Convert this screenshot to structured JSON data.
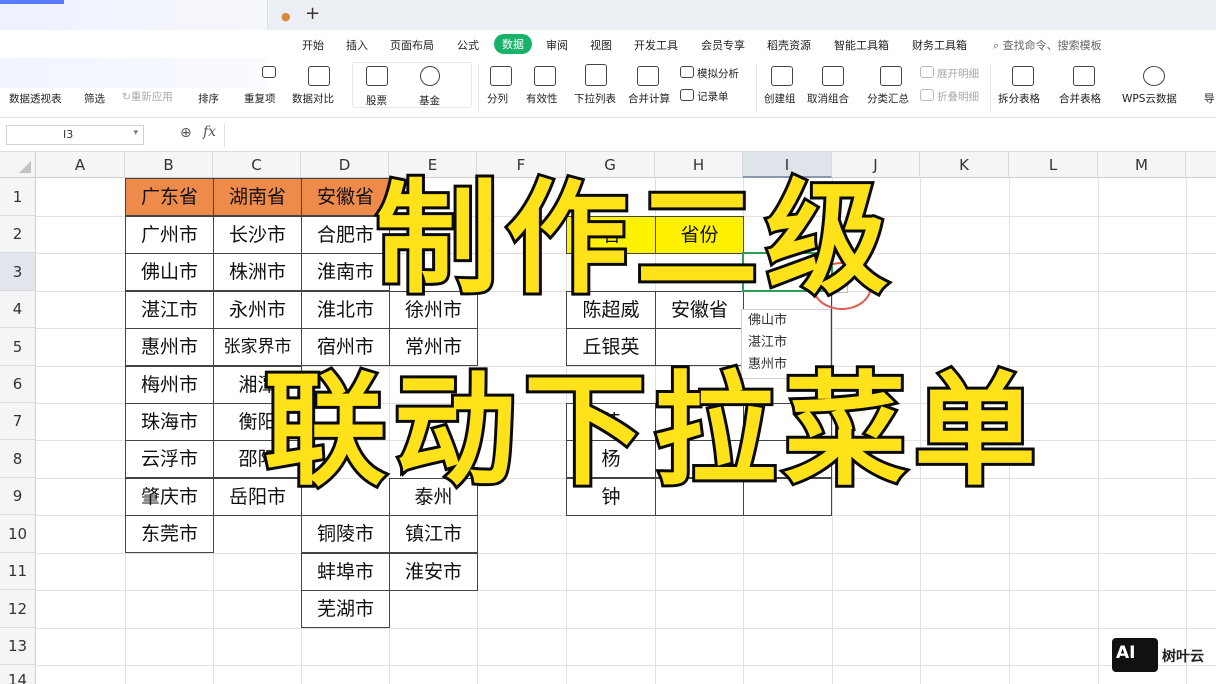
{
  "ribbon": {
    "menus": [
      "开始",
      "插入",
      "页面布局",
      "公式",
      "数据",
      "审阅",
      "视图",
      "开发工具",
      "会员专享",
      "稻壳资源",
      "智能工具箱",
      "财务工具箱"
    ],
    "active_menu": "数据",
    "search_placeholder": "查找命令、搜索模板",
    "tools": {
      "pivot": "数据透视表",
      "filter": "筛选",
      "reapply": "重新应用",
      "sort": "排序",
      "duplicates": "重复项",
      "compare": "数据对比",
      "stock": "股票",
      "fund": "基金",
      "split": "分列",
      "validity": "有效性",
      "dropdown_list": "下拉列表",
      "consolidate": "合并计算",
      "simulate": "模拟分析",
      "record": "记录单",
      "create_group": "创建组",
      "ungroup": "取消组合",
      "subtotal": "分类汇总",
      "expand_detail": "展开明细",
      "collapse_detail": "折叠明细",
      "split_table": "拆分表格",
      "merge_table": "合并表格",
      "wps_cloud": "WPS云数据",
      "more": "导"
    }
  },
  "formula_bar": {
    "cell_ref": "I3",
    "fx": "fx",
    "value": ""
  },
  "sheet": {
    "columns": [
      "A",
      "B",
      "C",
      "D",
      "E",
      "F",
      "G",
      "H",
      "I",
      "J",
      "K",
      "L",
      "M"
    ],
    "rows": [
      "1",
      "2",
      "3",
      "4",
      "5",
      "6",
      "7",
      "8",
      "9",
      "10",
      "11",
      "12",
      "13",
      "14"
    ],
    "selected_column": "I",
    "selected_row": "3",
    "col_B": {
      "header": "广东省",
      "items": [
        "广州市",
        "佛山市",
        "湛江市",
        "惠州市",
        "梅州市",
        "珠海市",
        "云浮市",
        "肇庆市",
        "东莞市"
      ]
    },
    "col_C": {
      "header": "湖南省",
      "items": [
        "长沙市",
        "株洲市",
        "永州市",
        "张家界市",
        "湘潭",
        "衡阳",
        "邵阳",
        "岳阳市"
      ]
    },
    "col_D": {
      "header": "安徽省",
      "items": [
        "合肥市",
        "淮南市",
        "淮北市",
        "宿州市",
        "铜陵市",
        "蚌埠市",
        "芜湖市"
      ]
    },
    "col_E": {
      "items": [
        "徐州市",
        "常州市",
        "泰州",
        "镇江市",
        "淮安市"
      ]
    },
    "lookup": {
      "g2": "名",
      "h2": "省份",
      "g4": "陈超威",
      "h4": "安徽省",
      "g5": "丘银英",
      "g7": "苏",
      "g8": "杨",
      "g9": "钟"
    },
    "dropdown_options": [
      "佛山市",
      "湛江市",
      "惠州市"
    ]
  },
  "overlay": {
    "line1": "制作二级",
    "line2": "联动下拉菜单"
  },
  "watermark": {
    "logo": "AI",
    "text": "树叶云"
  },
  "colors": {
    "accent_green": "#19b26b",
    "header_orange": "#ef8b4a",
    "title_yellow": "#ffe21a",
    "highlight_yellow": "#ffee00",
    "ring_red": "#e05a4e"
  }
}
